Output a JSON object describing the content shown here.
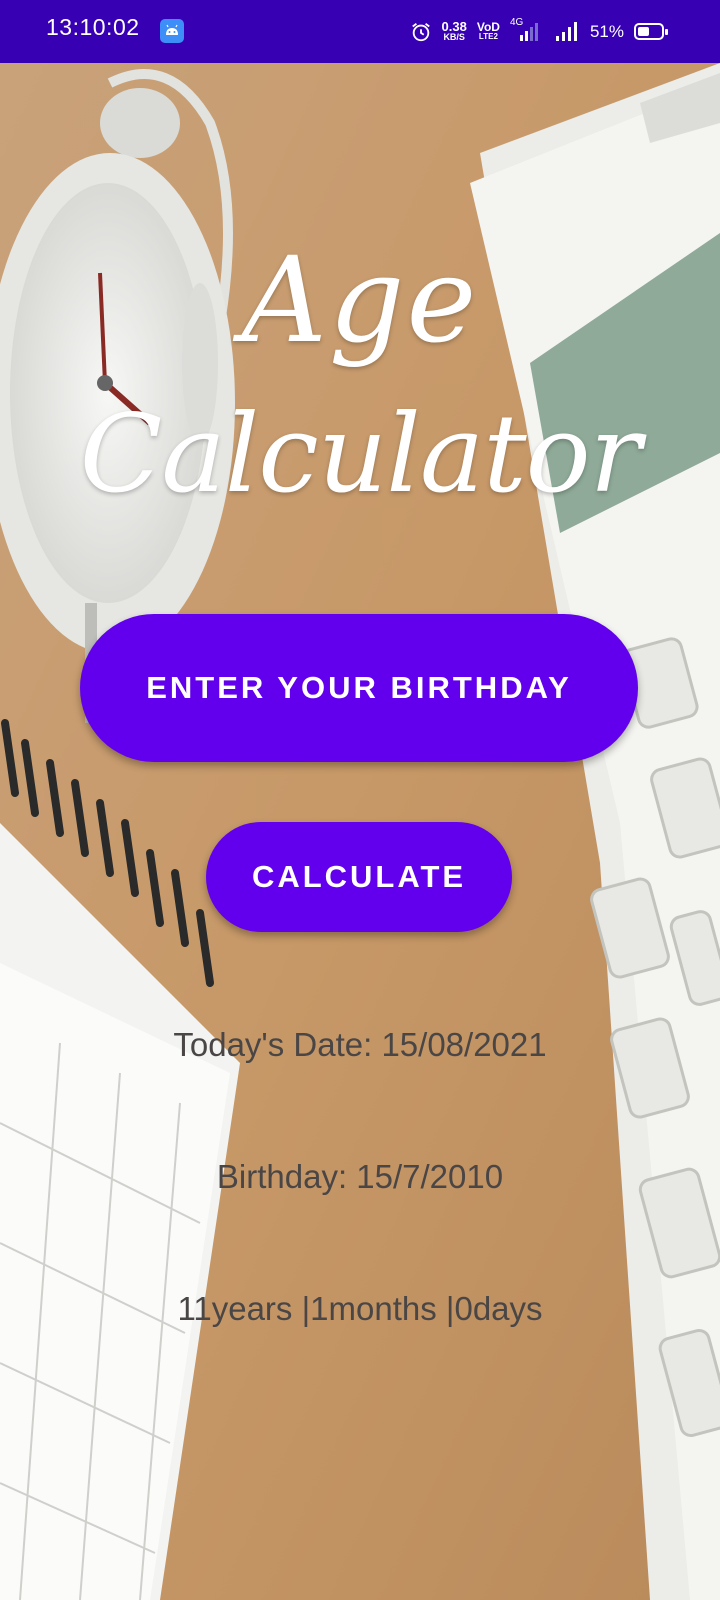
{
  "status_bar": {
    "time": "13:10:02",
    "net_speed_value": "0.38",
    "net_speed_unit": "KB/S",
    "volte_top": "VoD",
    "volte_bottom": "LTE2",
    "network_type": "4G",
    "battery_percent": "51%",
    "battery_level": 0.51,
    "app_icon": "android-debug-icon",
    "alarm_icon": "alarm-clock-icon",
    "bar_color": "#3700b3"
  },
  "app": {
    "title_line1": "Age",
    "title_line2": "Calculator",
    "enter_birthday_label": "ENTER YOUR BIRTHDAY",
    "calculate_label": "CALCULATE",
    "today_text": "Today's Date: 15/08/2021",
    "birthday_text": "Birthday: 15/7/2010",
    "age_text": "11years |1months |0days",
    "accent_color": "#6200ee"
  }
}
